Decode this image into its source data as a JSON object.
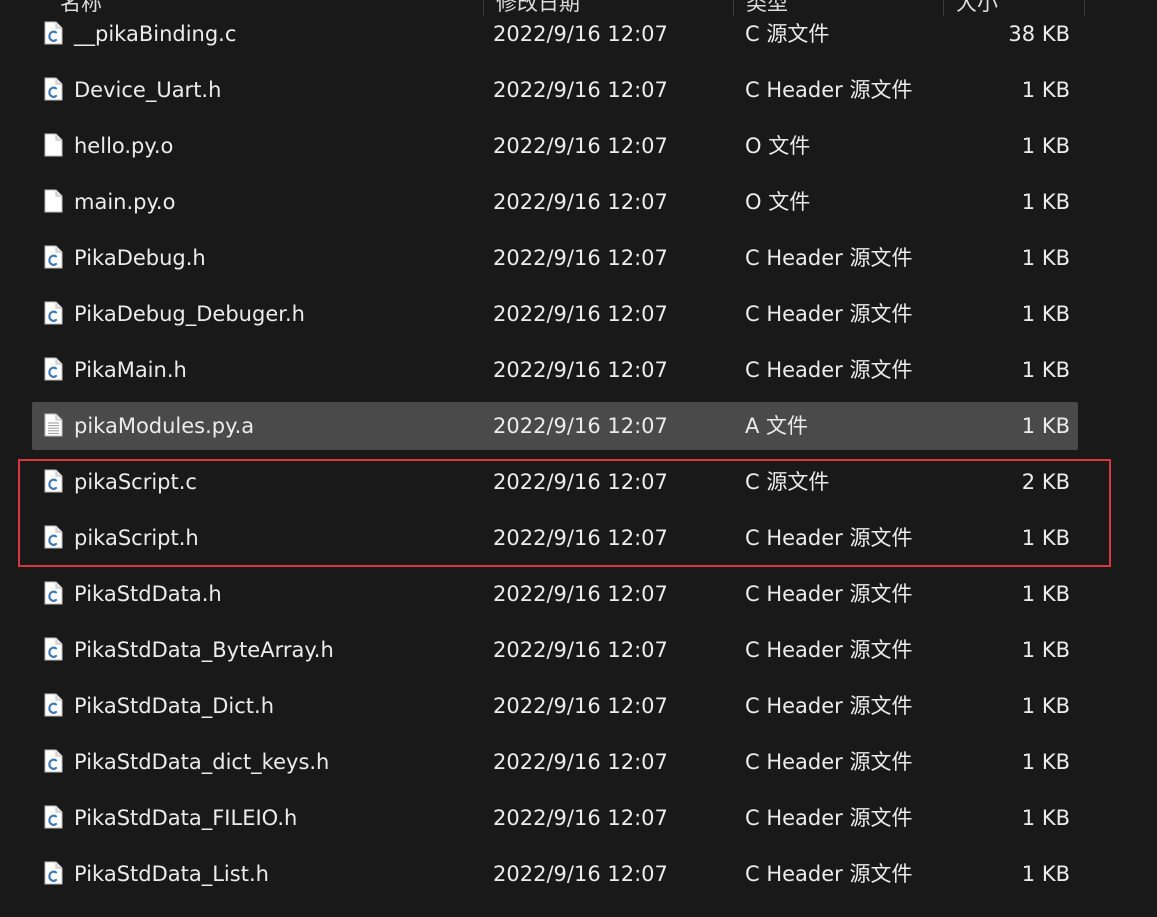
{
  "header": {
    "columns": [
      "名称",
      "修改日期",
      "类型",
      "大小"
    ]
  },
  "files": [
    {
      "name": "__pikaBinding.c",
      "date": "2022/9/16 12:07",
      "type": "C 源文件",
      "size": "38 KB",
      "icon": "c-source-file-icon"
    },
    {
      "name": "Device_Uart.h",
      "date": "2022/9/16 12:07",
      "type": "C Header 源文件",
      "size": "1 KB",
      "icon": "c-source-file-icon"
    },
    {
      "name": "hello.py.o",
      "date": "2022/9/16 12:07",
      "type": "O 文件",
      "size": "1 KB",
      "icon": "blank-file-icon"
    },
    {
      "name": "main.py.o",
      "date": "2022/9/16 12:07",
      "type": "O 文件",
      "size": "1 KB",
      "icon": "blank-file-icon"
    },
    {
      "name": "PikaDebug.h",
      "date": "2022/9/16 12:07",
      "type": "C Header 源文件",
      "size": "1 KB",
      "icon": "c-source-file-icon"
    },
    {
      "name": "PikaDebug_Debuger.h",
      "date": "2022/9/16 12:07",
      "type": "C Header 源文件",
      "size": "1 KB",
      "icon": "c-source-file-icon"
    },
    {
      "name": "PikaMain.h",
      "date": "2022/9/16 12:07",
      "type": "C Header 源文件",
      "size": "1 KB",
      "icon": "c-source-file-icon"
    },
    {
      "name": "pikaModules.py.a",
      "date": "2022/9/16 12:07",
      "type": "A 文件",
      "size": "1 KB",
      "icon": "text-file-icon"
    },
    {
      "name": "pikaScript.c",
      "date": "2022/9/16 12:07",
      "type": "C 源文件",
      "size": "2 KB",
      "icon": "c-source-file-icon"
    },
    {
      "name": "pikaScript.h",
      "date": "2022/9/16 12:07",
      "type": "C Header 源文件",
      "size": "1 KB",
      "icon": "c-source-file-icon"
    },
    {
      "name": "PikaStdData.h",
      "date": "2022/9/16 12:07",
      "type": "C Header 源文件",
      "size": "1 KB",
      "icon": "c-source-file-icon"
    },
    {
      "name": "PikaStdData_ByteArray.h",
      "date": "2022/9/16 12:07",
      "type": "C Header 源文件",
      "size": "1 KB",
      "icon": "c-source-file-icon"
    },
    {
      "name": "PikaStdData_Dict.h",
      "date": "2022/9/16 12:07",
      "type": "C Header 源文件",
      "size": "1 KB",
      "icon": "c-source-file-icon"
    },
    {
      "name": "PikaStdData_dict_keys.h",
      "date": "2022/9/16 12:07",
      "type": "C Header 源文件",
      "size": "1 KB",
      "icon": "c-source-file-icon"
    },
    {
      "name": "PikaStdData_FILEIO.h",
      "date": "2022/9/16 12:07",
      "type": "C Header 源文件",
      "size": "1 KB",
      "icon": "c-source-file-icon"
    },
    {
      "name": "PikaStdData_List.h",
      "date": "2022/9/16 12:07",
      "type": "C Header 源文件",
      "size": "1 KB",
      "icon": "c-source-file-icon"
    }
  ],
  "hovered_file": "pikaModules.py.a",
  "highlighted_files": [
    "pikaScript.c",
    "pikaScript.h"
  ],
  "colors": {
    "background": "#191919",
    "hover_row": "#4a4a4a",
    "highlight_border": "#d9363e",
    "c_icon_letter": "#3a7bb5"
  }
}
